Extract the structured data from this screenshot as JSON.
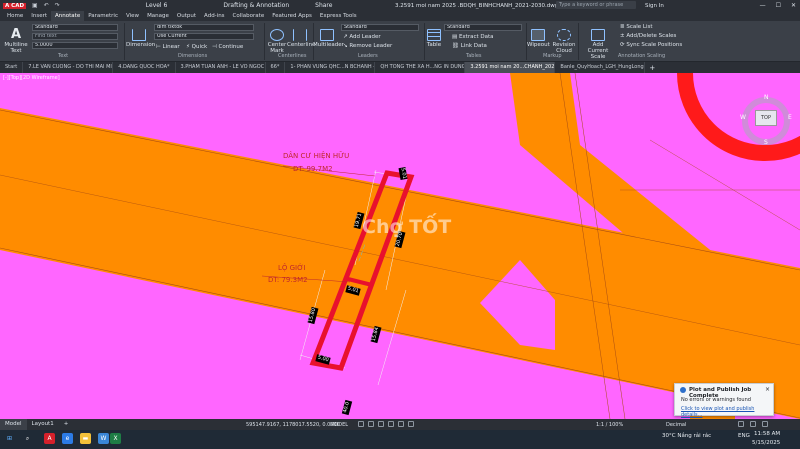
{
  "titlebar": {
    "logo": "A CAD",
    "workspace": "Level 6",
    "drafting": "Drafting & Annotation",
    "share": "Share",
    "title": "3.2591 moi nam 2025 .BDQH_BINHCHANH_2021-2030.dwg",
    "search_placeholder": "Type a keyword or phrase",
    "sign_in": "Sign In"
  },
  "menu_tabs": [
    "Home",
    "Insert",
    "Annotate",
    "Parametric",
    "View",
    "Manage",
    "Output",
    "Add-ins",
    "Collaborate",
    "Featured Apps",
    "Express Tools"
  ],
  "ribbon": {
    "text": {
      "multiline": "Multiline\nText",
      "style": "Standard",
      "find": "Find text",
      "height": "5.0000",
      "panel": "Text"
    },
    "dimensions": {
      "dimension": "Dimension",
      "style": "dim tiktok",
      "use_current": "Use Current",
      "linear": "Linear",
      "quick": "Quick",
      "continue": "Continue",
      "panel": "Dimensions"
    },
    "centerlines": {
      "center_mark": "Center\nMark",
      "centerline": "Centerline",
      "panel": "Centerlines"
    },
    "leaders": {
      "multileader": "Multileader",
      "style": "Standard",
      "add": "Add Leader",
      "remove": "Remove Leader",
      "panel": "Leaders"
    },
    "tables": {
      "table": "Table",
      "style": "Standard",
      "extract": "Extract Data",
      "link": "Link Data",
      "panel": "Tables"
    },
    "markup": {
      "wipeout": "Wipeout",
      "revision": "Revision\nCloud",
      "panel": "Markup"
    },
    "scaling": {
      "add_current": "Add\nCurrent Scale",
      "scale_list": "Scale List",
      "add_delete": "Add/Delete Scales",
      "sync": "Sync Scale Positions",
      "panel": "Annotation Scaling"
    }
  },
  "doc_tabs": [
    "Start",
    "7.LE VAN CUONG - DO THI MAI MIEN 567",
    "4.DANG QUOC HOA*",
    "3.PHAM TUAN ANH - LE VO NGOC THAO*",
    "66*",
    "1- PHAN VUNG QHC...N BCHANH - MOI*",
    "QH TONG THE XA H...NG IN DUNG TY LE*",
    "3.2591 moi nam 20...CHANH_2021-2030*",
    "Banle_QuyHoach_LGH_HungLong"
  ],
  "active_doc_tab": 7,
  "view_label": "[-][Top][2D Wireframe]",
  "drawing": {
    "label_residential": "DÂN CƯ HIỆN HỮU",
    "area_residential": "DT: 99.7M2",
    "label_road": "LỘ GIỚI",
    "area_road": "DT: 79.3M2",
    "dims": [
      "5.01",
      "19.71",
      "20.70",
      "5.01",
      "15.80",
      "15.84",
      "5.00",
      "40.0"
    ],
    "watermark": "Chợ TỐT"
  },
  "viewcube": {
    "top": "TOP",
    "n": "N",
    "s": "S",
    "e": "E",
    "w": "W"
  },
  "statusbar": {
    "model_tab": "Model",
    "layout_tab": "Layout1",
    "coords": "595147.9167, 1178017.5520, 0.0000",
    "model": "MODEL",
    "scale": "1:1 / 100%",
    "units": "Decimal"
  },
  "toast": {
    "title": "Plot and Publish Job Complete",
    "message": "No errors or warnings found",
    "link": "Click to view plot and publish details..."
  },
  "taskbar": {
    "weather": "30°C  Nắng rải rác",
    "lang": "ENG",
    "time": "11:58 AM",
    "date": "5/15/2025"
  },
  "colors": {
    "pink": "#ff66ff",
    "orange": "#ff8c00",
    "red": "#e8112d",
    "brand": "#d4202b"
  }
}
